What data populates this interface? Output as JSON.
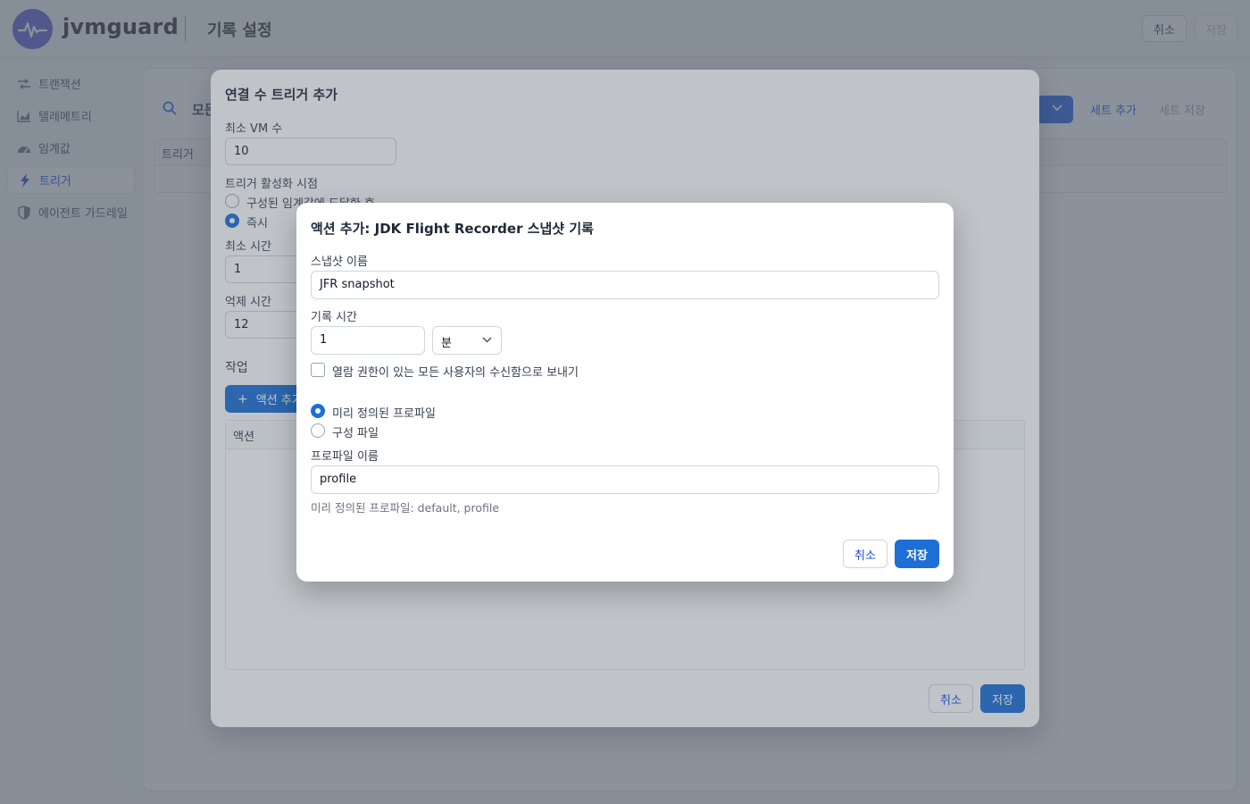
{
  "app": {
    "brand": "jvmguard",
    "page_title": "기록 설정",
    "cancel_label": "취소",
    "save_label": "저장",
    "accent_color": "#1d6fd6",
    "logo_color": "#5b5fd6"
  },
  "sidebar": {
    "items": [
      {
        "label": "트랜잭션",
        "icon": "transaction-icon"
      },
      {
        "label": "텔레메트리",
        "icon": "telemetry-chart-icon"
      },
      {
        "label": "임계값",
        "icon": "gauge-icon"
      },
      {
        "label": "트리거",
        "icon": "lightning-icon",
        "active": true
      },
      {
        "label": "에이전트 가드레일",
        "icon": "shield-icon"
      }
    ]
  },
  "background": {
    "search_text": "모든",
    "table_header": "트리거",
    "add_set_label": "세트 추가",
    "save_set_label": "세트 저장"
  },
  "trigger_dialog": {
    "title": "연결 수 트리거 추가",
    "min_vm_label": "최소 VM 수",
    "min_vm_value": "10",
    "activation_label": "트리거 활성화 시점",
    "activation_options": [
      "구성된 임계값에 도달한 후",
      "즉시"
    ],
    "activation_selected": "즉시",
    "min_time_label": "최소 시간",
    "min_time_value": "1",
    "suppress_label": "억제 시간",
    "suppress_value": "12",
    "actions_section": "작업",
    "add_action_label": "액션 추가",
    "actions_table_header": "액션",
    "cancel_label": "취소",
    "save_label": "저장"
  },
  "action_dialog": {
    "title": "액션 추가: JDK Flight Recorder 스냅샷 기록",
    "snapshot_name_label": "스냅샷 이름",
    "snapshot_name_value": "JFR snapshot",
    "record_time_label": "기록 시간",
    "record_time_value": "1",
    "record_time_unit": "분",
    "send_inbox_label": "열람 권한이 있는 모든 사용자의 수신함으로 보내기",
    "send_inbox_checked": false,
    "profile_options": [
      "미리 정의된 프로파일",
      "구성 파일"
    ],
    "profile_selected": "미리 정의된 프로파일",
    "profile_name_label": "프로파일 이름",
    "profile_name_value": "profile",
    "profile_hint": "미리 정의된 프로파일: default, profile",
    "cancel_label": "취소",
    "save_label": "저장"
  }
}
